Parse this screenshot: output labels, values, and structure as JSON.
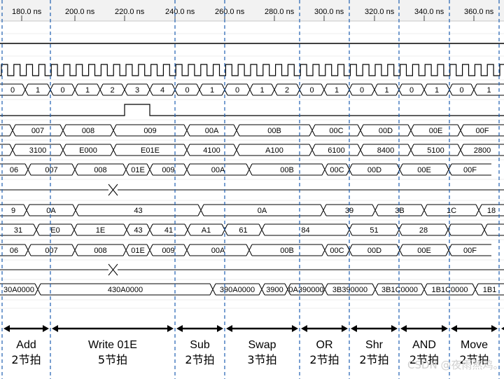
{
  "ruler": {
    "ticks": [
      "180.0 ns",
      "200.0 ns",
      "220.0 ns",
      "240.0 ns",
      "260.0 ns",
      "280.0 ns",
      "300.0 ns",
      "320.0 ns",
      "340.0 ns",
      "360.0 ns"
    ]
  },
  "rows": [
    {
      "id": "reset",
      "kind": "level",
      "level": "high"
    },
    {
      "id": "clock",
      "kind": "clock"
    },
    {
      "id": "beat-counter",
      "kind": "bus",
      "segments": [
        "0",
        "1",
        "0",
        "1",
        "2",
        "3",
        "4",
        "0",
        "1",
        "0",
        "1",
        "2",
        "0",
        "1",
        "0",
        "1",
        "0",
        "1",
        "0",
        "1"
      ]
    },
    {
      "id": "write-pulse",
      "kind": "pulse"
    },
    {
      "id": "pc",
      "kind": "bus",
      "segments": [
        "",
        "007",
        "008",
        "009",
        "00A",
        "00B",
        "00C",
        "00D",
        "00E",
        "00F"
      ]
    },
    {
      "id": "ir",
      "kind": "bus",
      "segments": [
        "",
        "3100",
        "E000",
        "E01E",
        "4100",
        "A100",
        "6100",
        "8400",
        "5100",
        "2800"
      ]
    },
    {
      "id": "address-bus",
      "kind": "bus",
      "segments": [
        "06",
        "007",
        "008",
        "01E",
        "009",
        "00A",
        "00B",
        "00C",
        "00D",
        "00E",
        "00F"
      ]
    },
    {
      "id": "mem-write",
      "kind": "strobe"
    },
    {
      "id": "acc",
      "kind": "bus",
      "segments": [
        "9",
        "0A",
        "43",
        "0A",
        "39",
        "3B",
        "1C",
        "18"
      ]
    },
    {
      "id": "data-bus",
      "kind": "bus",
      "segments": [
        "31",
        "E0",
        "1E",
        "43",
        "41",
        "A1",
        "61",
        "84",
        "51",
        "28"
      ]
    },
    {
      "id": "address-bus-2",
      "kind": "bus",
      "segments": [
        "06",
        "007",
        "008",
        "01E",
        "009",
        "00A",
        "00B",
        "00C",
        "00D",
        "00E",
        "00F"
      ]
    },
    {
      "id": "mem-write-2",
      "kind": "strobe"
    },
    {
      "id": "registers",
      "kind": "bus",
      "segments": [
        "30A0000",
        "430A0000",
        "390A0000",
        "3900",
        "0A390000",
        "3B390000",
        "3B1C0000",
        "1B1C0000",
        "1B1"
      ]
    }
  ],
  "instructions": [
    {
      "name": "Add",
      "beats": "2节拍"
    },
    {
      "name": "Write 01E",
      "beats": "5节拍"
    },
    {
      "name": "Sub",
      "beats": "2节拍"
    },
    {
      "name": "Swap",
      "beats": "3节拍"
    },
    {
      "name": "OR",
      "beats": "2节拍"
    },
    {
      "name": "Shr",
      "beats": "2节拍"
    },
    {
      "name": "AND",
      "beats": "2节拍"
    },
    {
      "name": "Move",
      "beats": "2节拍"
    }
  ],
  "watermark": "CSDN @夜雨熬鸡。",
  "colors": {
    "wave": "#000000",
    "cursor": "#1f5fb0",
    "ruler_bg": "#f2f2f2",
    "grid": "#d9d9d9"
  }
}
